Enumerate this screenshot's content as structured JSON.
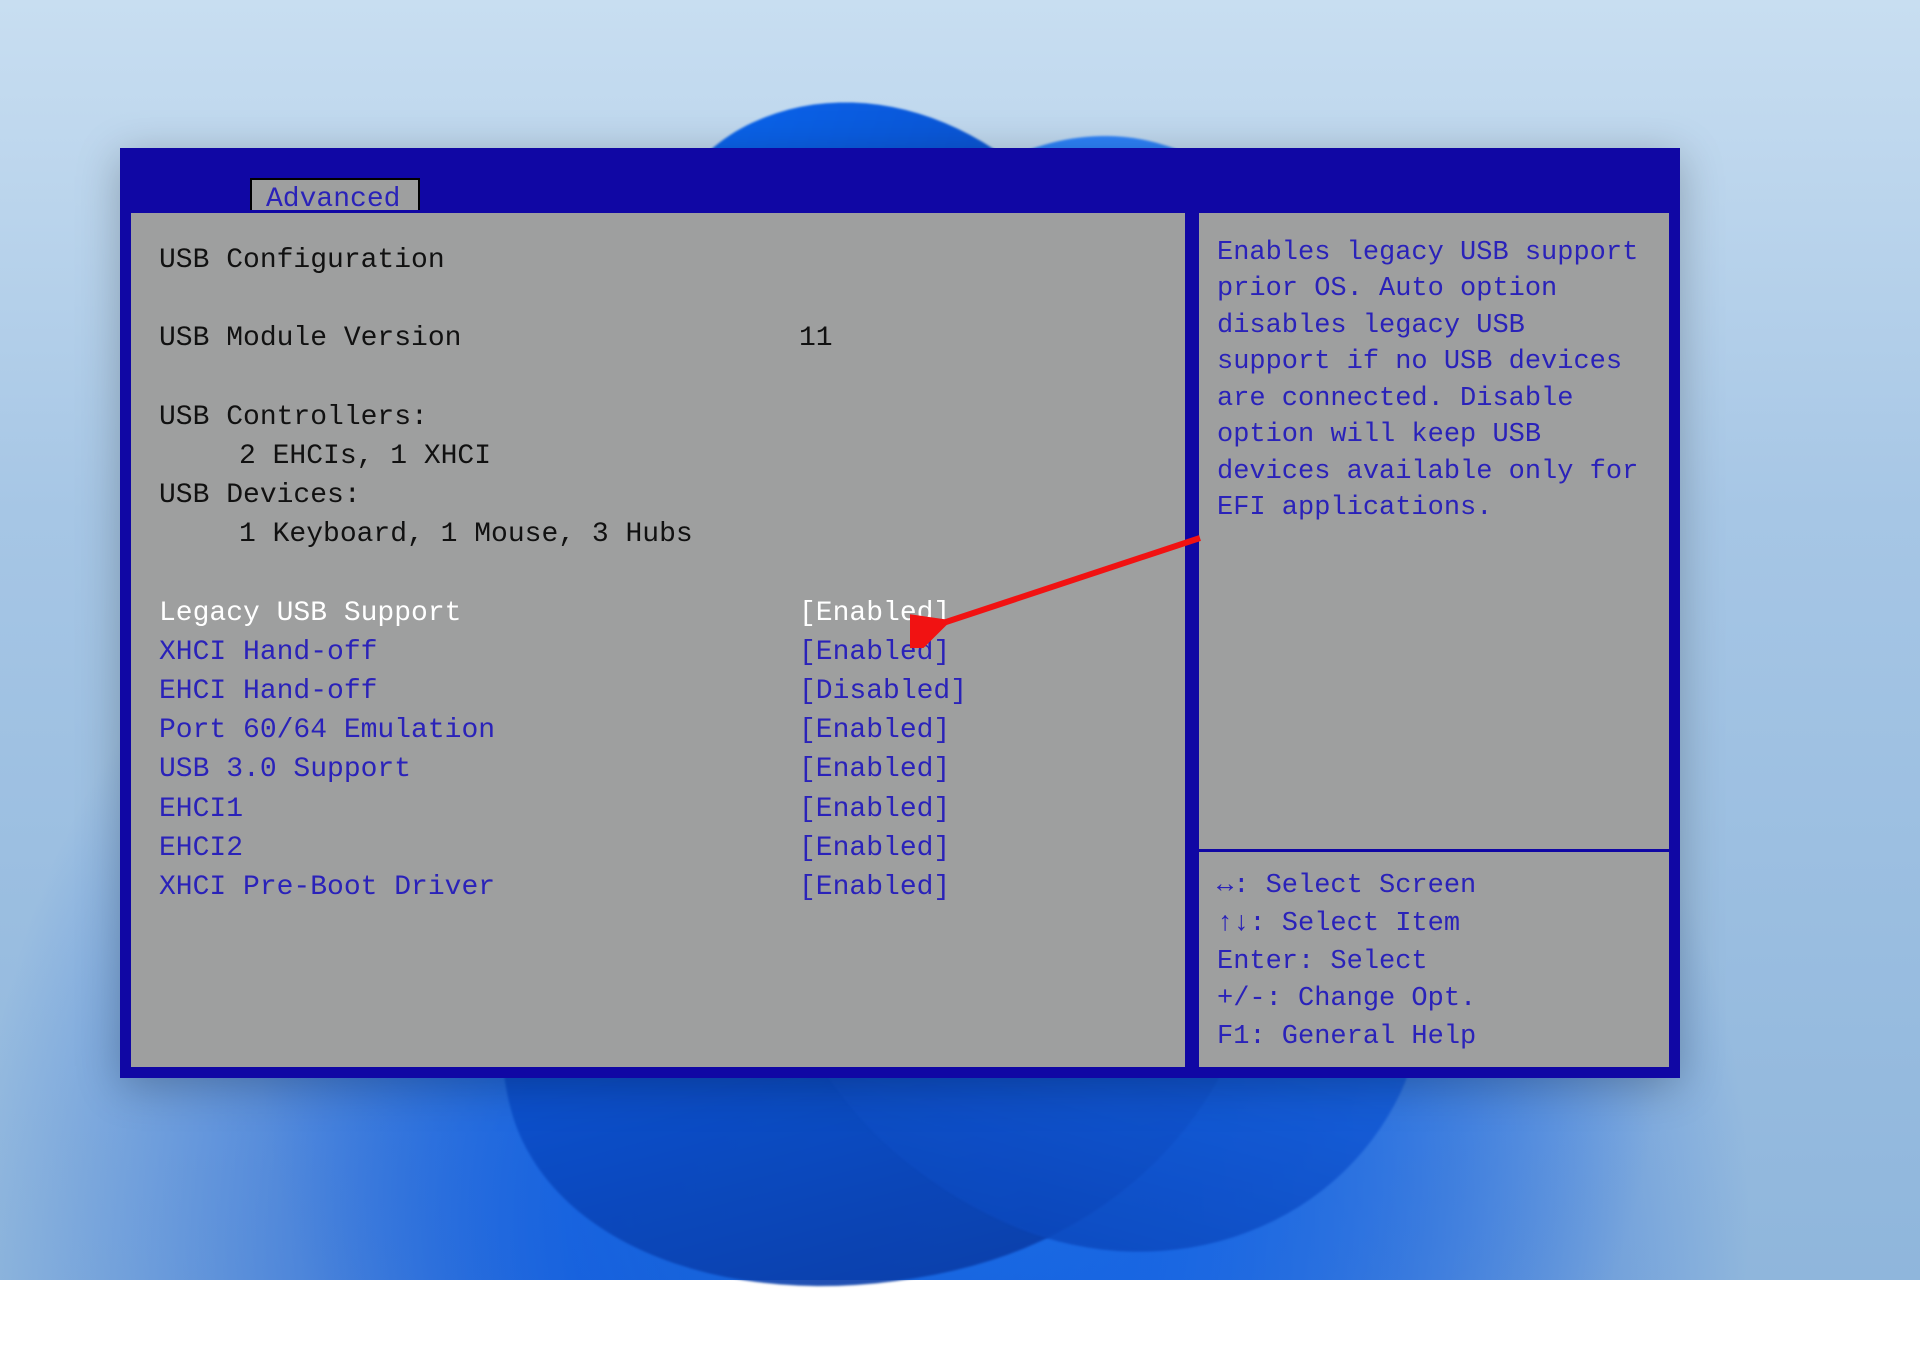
{
  "tab": {
    "label": "Advanced"
  },
  "main": {
    "title": "USB Configuration",
    "module_version_label": "USB Module Version",
    "module_version_value": "11",
    "controllers_label": "USB Controllers:",
    "controllers_value": "2 EHCIs, 1 XHCI",
    "devices_label": "USB Devices:",
    "devices_value": "1 Keyboard, 1 Mouse, 3 Hubs",
    "options": [
      {
        "label": "Legacy USB Support",
        "value": "[Enabled]",
        "selected": true
      },
      {
        "label": "XHCI Hand-off",
        "value": "[Enabled]",
        "selected": false
      },
      {
        "label": "EHCI Hand-off",
        "value": "[Disabled]",
        "selected": false
      },
      {
        "label": "Port 60/64 Emulation",
        "value": "[Enabled]",
        "selected": false
      },
      {
        "label": "USB 3.0 Support",
        "value": "[Enabled]",
        "selected": false
      },
      {
        "label": "EHCI1",
        "value": "[Enabled]",
        "selected": false
      },
      {
        "label": "EHCI2",
        "value": "[Enabled]",
        "selected": false
      },
      {
        "label": "XHCI Pre-Boot Driver",
        "value": "[Enabled]",
        "selected": false
      }
    ]
  },
  "help": {
    "description": "Enables legacy USB support prior OS. Auto option disables legacy USB support if no USB devices are connected. Disable option will keep USB devices available only for EFI applications.",
    "keys": [
      {
        "key": "↔",
        "action": "Select Screen"
      },
      {
        "key": "↑↓",
        "action": "Select Item"
      },
      {
        "key": "Enter",
        "action": "Select"
      },
      {
        "key": "+/-",
        "action": "Change Opt."
      },
      {
        "key": "F1",
        "action": "General Help"
      }
    ]
  },
  "annotation": {
    "arrow_color": "#f11212",
    "points_at": "Legacy USB Support value"
  }
}
